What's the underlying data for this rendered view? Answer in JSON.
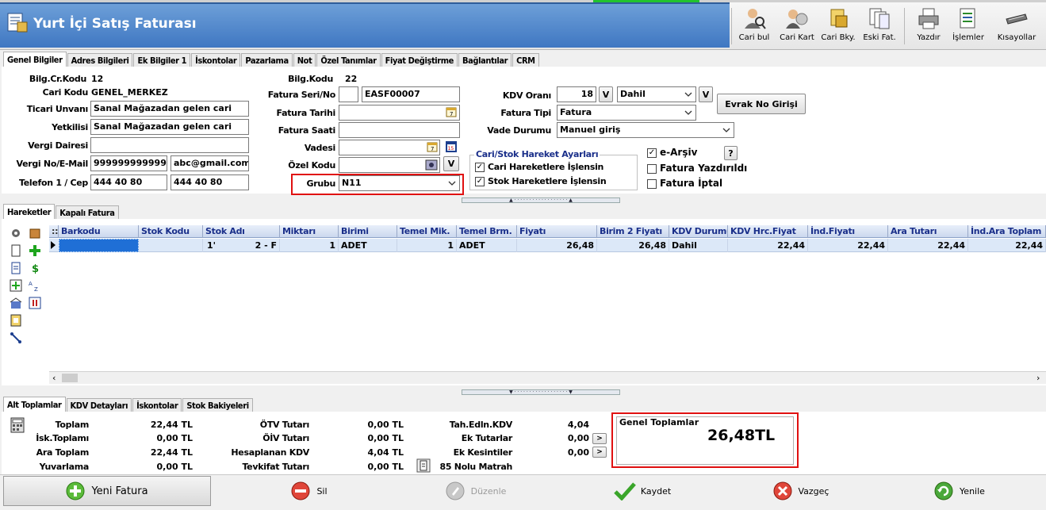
{
  "window": {
    "title": "Yurt İçi Satış Faturası"
  },
  "toolbar": [
    {
      "label": "Cari bul",
      "icon": "person-search-icon"
    },
    {
      "label": "Cari Kart",
      "icon": "contact-card-icon"
    },
    {
      "label": "Cari Bky.",
      "icon": "balance-icon"
    },
    {
      "label": "Eski Fat.",
      "icon": "old-invoice-icon"
    },
    {
      "label": "Yazdır",
      "icon": "printer-icon"
    },
    {
      "label": "İşlemler",
      "icon": "operations-icon"
    },
    {
      "label": "Kısayollar",
      "icon": "keyboard-icon"
    }
  ],
  "tabs": [
    "Genel Bilgiler",
    "Adres Bilgileri",
    "Ek Bilgiler 1",
    "İskontolar",
    "Pazarlama",
    "Not",
    "Özel Tanımlar",
    "Fiyat Değiştirme",
    "Bağlantılar",
    "CRM"
  ],
  "form": {
    "cari_kodu_label": "Bilg.Cr.Kodu",
    "cari_kodu_value": "12",
    "cari_kod_label": "Cari Kodu",
    "cari_kod_value": "GENEL_MERKEZ",
    "ticari_label": "Ticari Unvanı",
    "ticari_value": "Sanal Mağazadan gelen cari",
    "yetkili_label": "Yetkilisi",
    "yetkili_value": "Sanal Mağazadan gelen cari",
    "vergi_dairesi_label": "Vergi Dairesi",
    "vergi_dairesi_value": "",
    "vergi_no_label": "Vergi No/E-Mail",
    "vergi_no_value": "999999999999",
    "email_value": "abc@gmail.com",
    "telefon_label": "Telefon 1 / Cep",
    "telefon1": "444 40 80",
    "cep": "444 40 80",
    "bilg_kodu_label": "Bilg.Kodu",
    "bilg_kodu_value": "22",
    "seri_label": "Fatura Seri/No",
    "seri_value": "",
    "no_value": "EASF00007",
    "tarih_label": "Fatura Tarihi",
    "tarih_value": "",
    "saat_label": "Fatura Saati",
    "saat_value": "",
    "vade_label": "Vadesi",
    "vade_value": "",
    "ozel_kod_label": "Özel Kodu",
    "ozel_kod_value": "",
    "grubu_label": "Grubu",
    "grubu_value": "N11",
    "kdv_orani_label": "KDV Oranı",
    "kdv_orani_value": "18",
    "kdv_dahil": "Dahil",
    "fatura_tipi_label": "Fatura Tipi",
    "fatura_tipi_value": "Fatura",
    "vade_durumu_label": "Vade Durumu",
    "vade_durumu_value": "Manuel giriş",
    "evrak_button": "Evrak No Girişi",
    "v_label": "V",
    "hareket_group": "Cari/Stok Hareket Ayarları",
    "cari_hareket": "Cari Hareketlere İşlensin",
    "stok_hareket": "Stok Hareketlere İşlensin",
    "earsiv": "e-Arşiv",
    "earsiv_help": "?",
    "yazdirildi": "Fatura Yazdırıldı",
    "iptal": "Fatura İptal"
  },
  "grid_tabs": [
    "Hareketler",
    "Kapalı Fatura"
  ],
  "grid": {
    "columns": [
      "Barkodu",
      "Stok Kodu",
      "Stok Adı",
      "Miktarı",
      "Birimi",
      "Temel Mik.",
      "Temel Brm.",
      "Fiyatı",
      "Birim 2 Fiyatı",
      "KDV Durumu",
      "KDV Hrc.Fiyat",
      "İnd.Fiyatı",
      "Ara Tutarı",
      "İnd.Ara Toplam"
    ],
    "rows": [
      [
        "",
        "",
        "1'",
        "1",
        "ADET",
        "1",
        "ADET",
        "26,48",
        "26,48",
        "Dahil",
        "22,44",
        "22,44",
        "22,44",
        "22,44"
      ]
    ],
    "stok_adi_tail": "2 - F"
  },
  "bottom_tabs": [
    "Alt Toplamlar",
    "KDV Detayları",
    "İskontolar",
    "Stok Bakiyeleri"
  ],
  "totals": {
    "toplam_label": "Toplam",
    "toplam": "22,44 TL",
    "isk_label": "İsk.Toplamı",
    "isk": "0,00 TL",
    "ara_label": "Ara Toplam",
    "ara": "22,44 TL",
    "yuv_label": "Yuvarlama",
    "yuv": "0,00 TL",
    "otv_label": "ÖTV Tutarı",
    "otv": "0,00 TL",
    "oiv_label": "ÖİV Tutarı",
    "oiv": "0,00 TL",
    "hkdv_label": "Hesaplanan KDV",
    "hkdv": "4,04 TL",
    "tevk_label": "Tevkifat Tutarı",
    "tevk": "0,00 TL",
    "tah_label": "Tah.Edln.KDV",
    "tah": "4,04",
    "ekt_label": "Ek Tutarlar",
    "ekt": "0,00",
    "eke_label": "Ek Kesintiler",
    "eke": "0,00",
    "matrah_label": "85 Nolu Matrah",
    "genel_label": "Genel Toplamlar",
    "genel": "26,48TL"
  },
  "actions": {
    "new": "Yeni Fatura",
    "delete": "Sil",
    "edit": "Düzenle",
    "save": "Kaydet",
    "cancel": "Vazgeç",
    "refresh": "Yenile"
  }
}
